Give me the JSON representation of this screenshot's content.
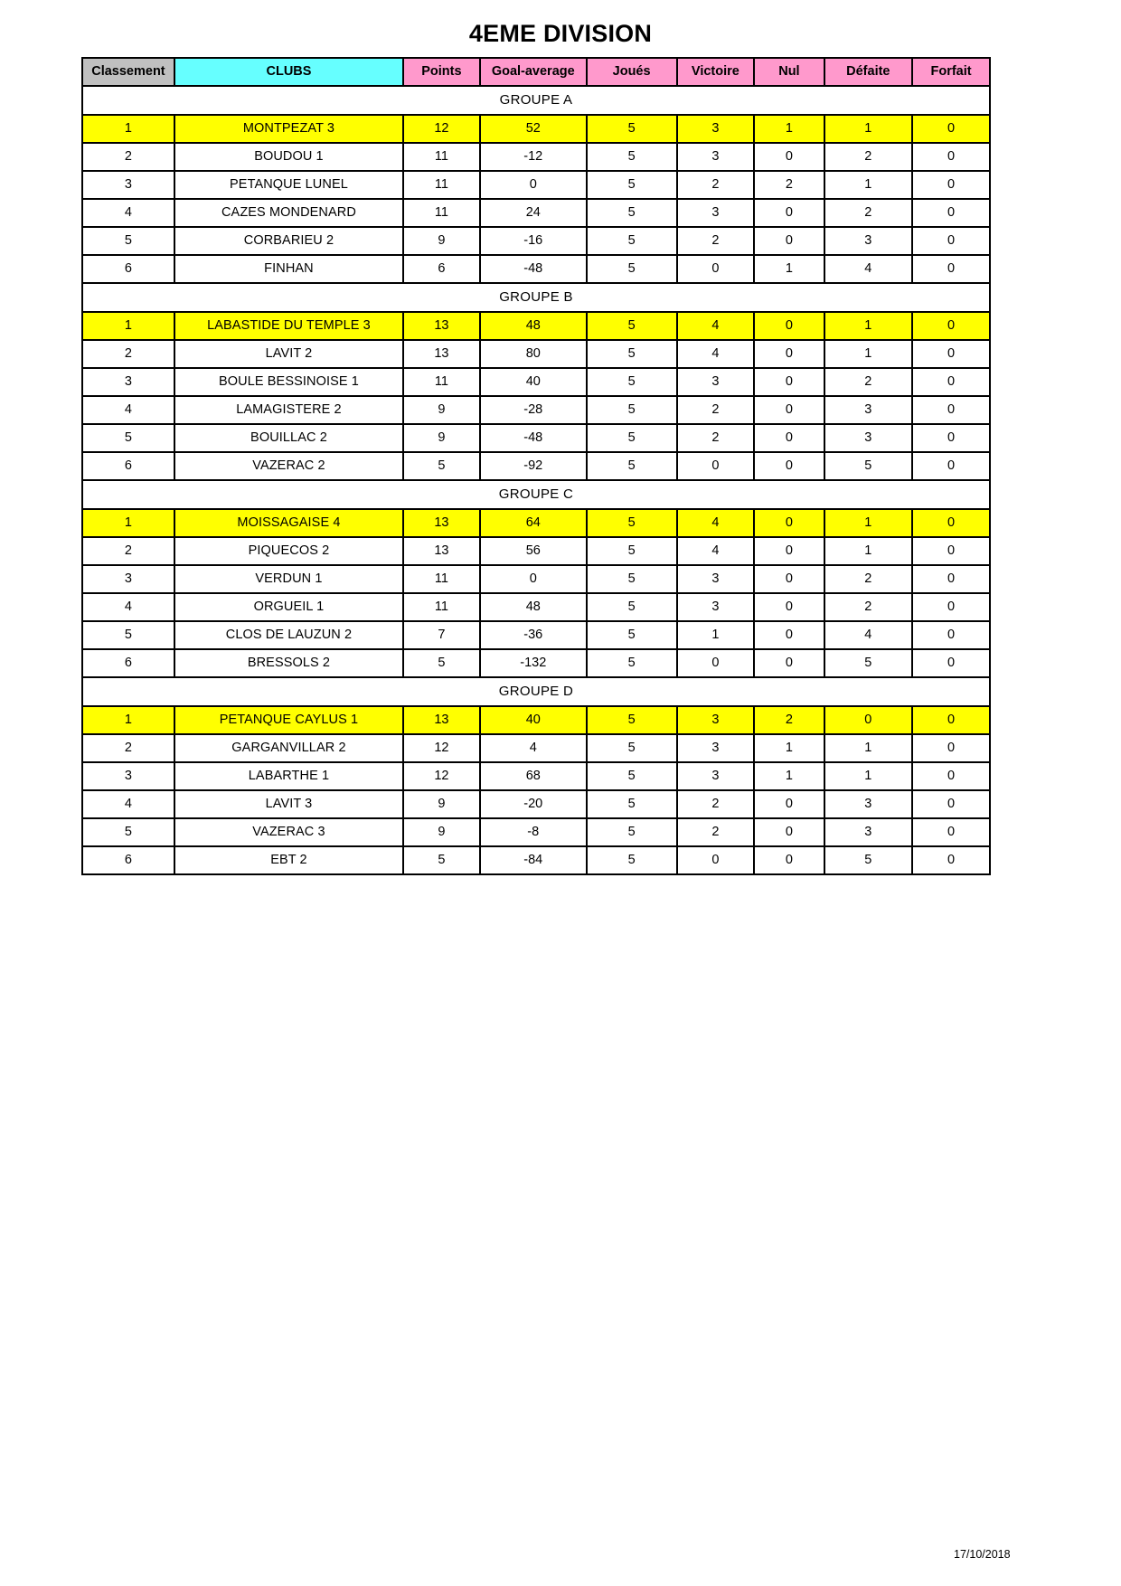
{
  "document": {
    "title": "4EME DIVISION",
    "date": "17/10/2018"
  },
  "table": {
    "headers": {
      "rank": "Classement",
      "club": "CLUBS",
      "points": "Points",
      "goal_average": "Goal-average",
      "played": "Joués",
      "wins": "Victoire",
      "draws": "Nul",
      "losses": "Défaite",
      "forfeits": "Forfait"
    },
    "colors": {
      "rank_header_bg": "#c0c0c0",
      "club_header_bg": "#66ffff",
      "stat_header_bg": "#ff99cc",
      "leader_row_bg": "#ffff00",
      "border": "#000000"
    },
    "groups": [
      {
        "label": "GROUPE A",
        "rows": [
          {
            "rank": "1",
            "club": "MONTPEZAT 3",
            "points": "12",
            "goal_average": "52",
            "played": "5",
            "wins": "3",
            "draws": "1",
            "losses": "1",
            "forfeits": "0",
            "leader": true
          },
          {
            "rank": "2",
            "club": "BOUDOU 1",
            "points": "11",
            "goal_average": "-12",
            "played": "5",
            "wins": "3",
            "draws": "0",
            "losses": "2",
            "forfeits": "0",
            "leader": false
          },
          {
            "rank": "3",
            "club": "PETANQUE LUNEL",
            "points": "11",
            "goal_average": "0",
            "played": "5",
            "wins": "2",
            "draws": "2",
            "losses": "1",
            "forfeits": "0",
            "leader": false
          },
          {
            "rank": "4",
            "club": "CAZES MONDENARD",
            "points": "11",
            "goal_average": "24",
            "played": "5",
            "wins": "3",
            "draws": "0",
            "losses": "2",
            "forfeits": "0",
            "leader": false
          },
          {
            "rank": "5",
            "club": "CORBARIEU 2",
            "points": "9",
            "goal_average": "-16",
            "played": "5",
            "wins": "2",
            "draws": "0",
            "losses": "3",
            "forfeits": "0",
            "leader": false
          },
          {
            "rank": "6",
            "club": "FINHAN",
            "points": "6",
            "goal_average": "-48",
            "played": "5",
            "wins": "0",
            "draws": "1",
            "losses": "4",
            "forfeits": "0",
            "leader": false
          }
        ]
      },
      {
        "label": "GROUPE B",
        "rows": [
          {
            "rank": "1",
            "club": "LABASTIDE DU TEMPLE 3",
            "points": "13",
            "goal_average": "48",
            "played": "5",
            "wins": "4",
            "draws": "0",
            "losses": "1",
            "forfeits": "0",
            "leader": true
          },
          {
            "rank": "2",
            "club": "LAVIT 2",
            "points": "13",
            "goal_average": "80",
            "played": "5",
            "wins": "4",
            "draws": "0",
            "losses": "1",
            "forfeits": "0",
            "leader": false
          },
          {
            "rank": "3",
            "club": "BOULE BESSINOISE 1",
            "points": "11",
            "goal_average": "40",
            "played": "5",
            "wins": "3",
            "draws": "0",
            "losses": "2",
            "forfeits": "0",
            "leader": false
          },
          {
            "rank": "4",
            "club": "LAMAGISTERE 2",
            "points": "9",
            "goal_average": "-28",
            "played": "5",
            "wins": "2",
            "draws": "0",
            "losses": "3",
            "forfeits": "0",
            "leader": false
          },
          {
            "rank": "5",
            "club": "BOUILLAC 2",
            "points": "9",
            "goal_average": "-48",
            "played": "5",
            "wins": "2",
            "draws": "0",
            "losses": "3",
            "forfeits": "0",
            "leader": false
          },
          {
            "rank": "6",
            "club": "VAZERAC 2",
            "points": "5",
            "goal_average": "-92",
            "played": "5",
            "wins": "0",
            "draws": "0",
            "losses": "5",
            "forfeits": "0",
            "leader": false
          }
        ]
      },
      {
        "label": "GROUPE C",
        "rows": [
          {
            "rank": "1",
            "club": "MOISSAGAISE 4",
            "points": "13",
            "goal_average": "64",
            "played": "5",
            "wins": "4",
            "draws": "0",
            "losses": "1",
            "forfeits": "0",
            "leader": true
          },
          {
            "rank": "2",
            "club": "PIQUECOS 2",
            "points": "13",
            "goal_average": "56",
            "played": "5",
            "wins": "4",
            "draws": "0",
            "losses": "1",
            "forfeits": "0",
            "leader": false
          },
          {
            "rank": "3",
            "club": "VERDUN 1",
            "points": "11",
            "goal_average": "0",
            "played": "5",
            "wins": "3",
            "draws": "0",
            "losses": "2",
            "forfeits": "0",
            "leader": false
          },
          {
            "rank": "4",
            "club": "ORGUEIL 1",
            "points": "11",
            "goal_average": "48",
            "played": "5",
            "wins": "3",
            "draws": "0",
            "losses": "2",
            "forfeits": "0",
            "leader": false
          },
          {
            "rank": "5",
            "club": "CLOS DE LAUZUN 2",
            "points": "7",
            "goal_average": "-36",
            "played": "5",
            "wins": "1",
            "draws": "0",
            "losses": "4",
            "forfeits": "0",
            "leader": false
          },
          {
            "rank": "6",
            "club": "BRESSOLS 2",
            "points": "5",
            "goal_average": "-132",
            "played": "5",
            "wins": "0",
            "draws": "0",
            "losses": "5",
            "forfeits": "0",
            "leader": false
          }
        ]
      },
      {
        "label": "GROUPE D",
        "rows": [
          {
            "rank": "1",
            "club": "PETANQUE CAYLUS 1",
            "points": "13",
            "goal_average": "40",
            "played": "5",
            "wins": "3",
            "draws": "2",
            "losses": "0",
            "forfeits": "0",
            "leader": true
          },
          {
            "rank": "2",
            "club": "GARGANVILLAR 2",
            "points": "12",
            "goal_average": "4",
            "played": "5",
            "wins": "3",
            "draws": "1",
            "losses": "1",
            "forfeits": "0",
            "leader": false
          },
          {
            "rank": "3",
            "club": "LABARTHE 1",
            "points": "12",
            "goal_average": "68",
            "played": "5",
            "wins": "3",
            "draws": "1",
            "losses": "1",
            "forfeits": "0",
            "leader": false
          },
          {
            "rank": "4",
            "club": "LAVIT 3",
            "points": "9",
            "goal_average": "-20",
            "played": "5",
            "wins": "2",
            "draws": "0",
            "losses": "3",
            "forfeits": "0",
            "leader": false
          },
          {
            "rank": "5",
            "club": "VAZERAC 3",
            "points": "9",
            "goal_average": "-8",
            "played": "5",
            "wins": "2",
            "draws": "0",
            "losses": "3",
            "forfeits": "0",
            "leader": false
          },
          {
            "rank": "6",
            "club": "EBT 2",
            "points": "5",
            "goal_average": "-84",
            "played": "5",
            "wins": "0",
            "draws": "0",
            "losses": "5",
            "forfeits": "0",
            "leader": false
          }
        ]
      }
    ]
  }
}
